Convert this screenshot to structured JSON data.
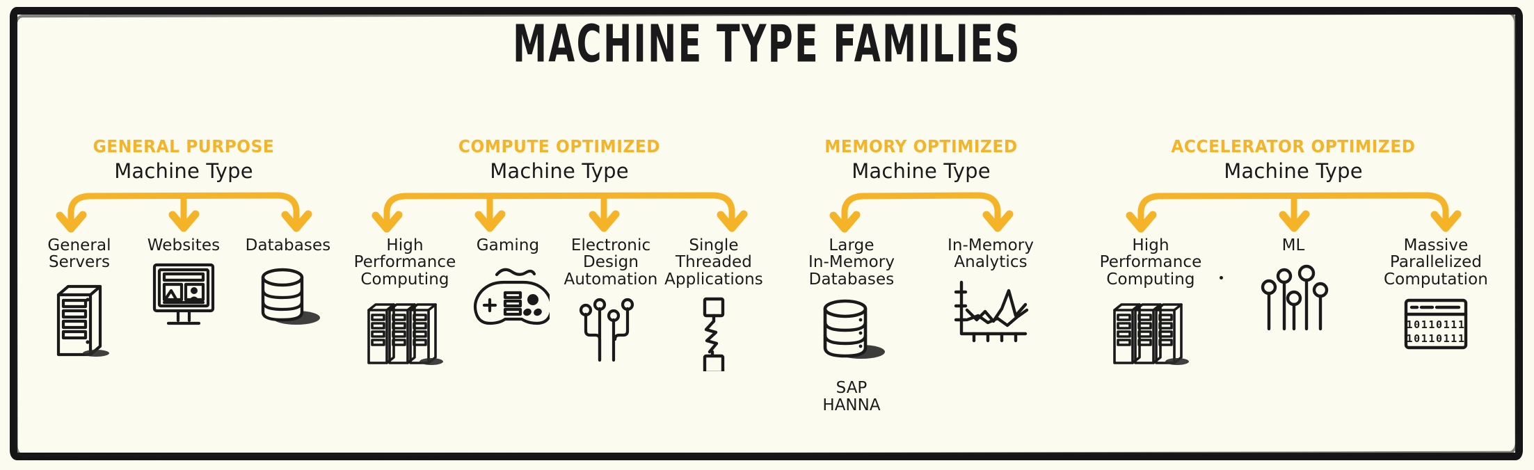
{
  "title": "MACHINE TYPE FAMILIES",
  "colors": {
    "accent": "#F5B427",
    "ink": "#1a1a1a",
    "background": "#FBFBF0",
    "frame": "#151515"
  },
  "columns": [
    {
      "kicker": "GENERAL PURPOSE",
      "subhead": "Machine Type",
      "items": [
        {
          "label": "General\nServers",
          "icon": "server-tower-icon"
        },
        {
          "label": "Websites",
          "icon": "browser-window-icon"
        },
        {
          "label": "Databases",
          "icon": "database-cylinder-icon"
        }
      ]
    },
    {
      "kicker": "COMPUTE OPTIMIZED",
      "subhead": "Machine Type",
      "items": [
        {
          "label": "High\nPerformance\nComputing",
          "icon": "server-rack-group-icon"
        },
        {
          "label": "Gaming",
          "icon": "gamepad-icon"
        },
        {
          "label": "Electronic\nDesign\nAutomation",
          "icon": "circuit-board-icon"
        },
        {
          "label": "Single\nThreaded\nApplications",
          "icon": "lightning-thread-icon"
        }
      ]
    },
    {
      "kicker": "MEMORY OPTIMIZED",
      "subhead": "Machine Type",
      "items": [
        {
          "label": "Large\nIn-Memory\nDatabases",
          "icon": "database-cylinder-icon",
          "caption": "SAP\nHANNA"
        },
        {
          "label": "In-Memory\nAnalytics",
          "icon": "line-chart-icon"
        }
      ]
    },
    {
      "kicker": "ACCELERATOR OPTIMIZED",
      "subhead": "Machine Type",
      "items": [
        {
          "label": "High\nPerformance\nComputing",
          "icon": "server-rack-group-icon"
        },
        {
          "label": "ML",
          "icon": "neural-nodes-icon"
        },
        {
          "label": "Massive\nParallelized\nComputation",
          "icon": "binary-code-window-icon"
        }
      ]
    }
  ],
  "binary_icon_text": [
    "10110111",
    "10110111"
  ]
}
